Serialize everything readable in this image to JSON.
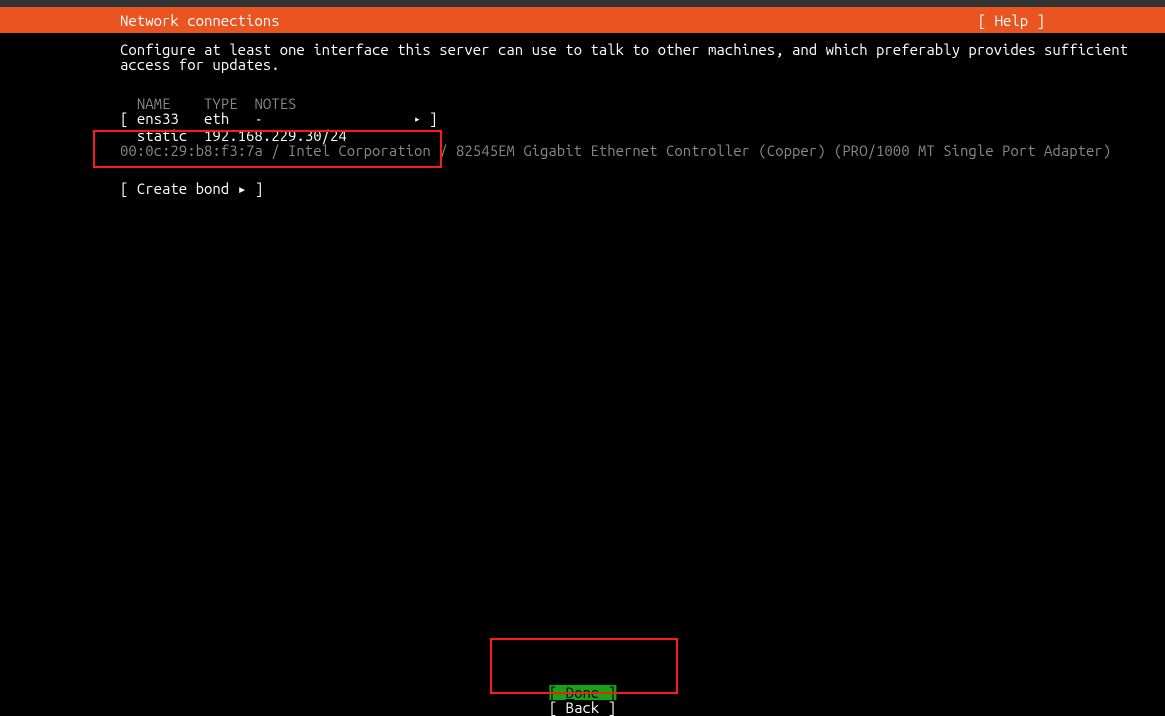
{
  "header": {
    "title": "Network connections",
    "help": "[ Help ]"
  },
  "description_line1": "Configure at least one interface this server can use to talk to other machines, and which preferably provides sufficient",
  "description_line2": "access for updates.",
  "columns": {
    "name": "NAME",
    "type": "TYPE",
    "notes": "NOTES"
  },
  "iface": {
    "name": "ens33",
    "type": "eth",
    "notes": "-",
    "mode": "static",
    "addr": "192.168.229.30/24",
    "details": "00:0c:29:b8:f3:7a / Intel Corporation / 82545EM Gigabit Ethernet Controller (Copper) (PRO/1000 MT Single Port Adapter)"
  },
  "create_bond": "[ Create bond ▸ ]",
  "buttons": {
    "done_open": "[ ",
    "done_text_u": "D",
    "done_text_r": "one       ",
    "done_close": "]",
    "back_open": "[ ",
    "back_text": "Back       ",
    "back_close": "]"
  }
}
